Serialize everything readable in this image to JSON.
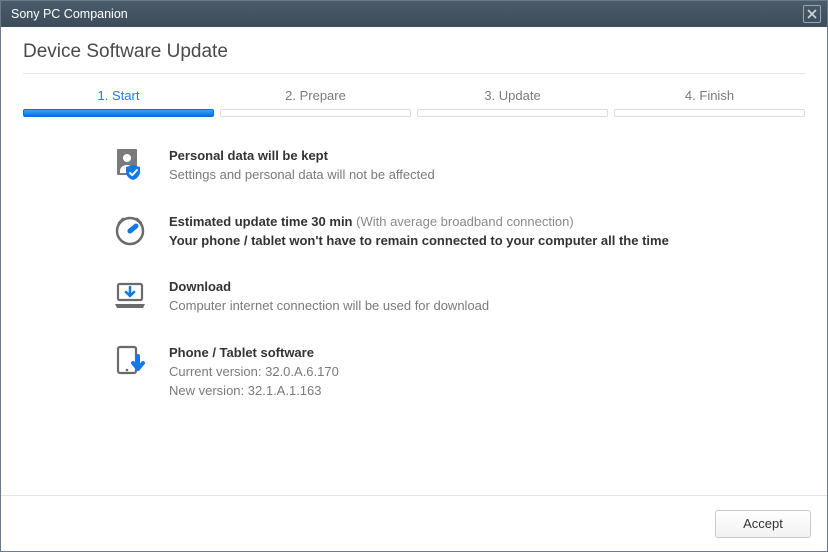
{
  "window": {
    "title": "Sony PC Companion"
  },
  "page": {
    "heading": "Device Software Update"
  },
  "steps": [
    {
      "label": "1. Start",
      "active": true
    },
    {
      "label": "2. Prepare",
      "active": false
    },
    {
      "label": "3. Update",
      "active": false
    },
    {
      "label": "4. Finish",
      "active": false
    }
  ],
  "info": {
    "personal": {
      "title": "Personal data will be kept",
      "sub": "Settings and personal data will not be affected"
    },
    "time": {
      "title": "Estimated update time 30 min",
      "paren": "(With average broadband connection)",
      "line2": "Your phone / tablet won't have to remain connected to your computer all the time"
    },
    "download": {
      "title": "Download",
      "sub": "Computer internet connection will be used for download"
    },
    "software": {
      "title": "Phone / Tablet software",
      "current_label": "Current version:",
      "current_value": "32.0.A.6.170",
      "new_label": "New version:",
      "new_value": "32.1.A.1.163"
    }
  },
  "footer": {
    "accept": "Accept"
  }
}
